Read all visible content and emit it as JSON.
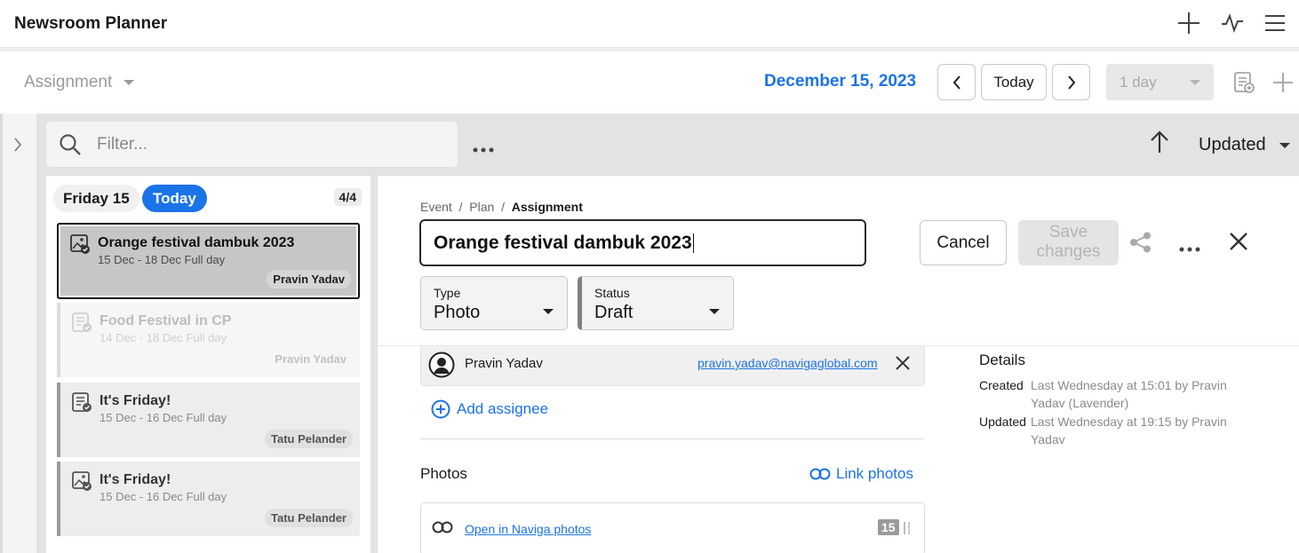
{
  "app": {
    "title": "Newsroom Planner"
  },
  "toolbar": {
    "view_label": "Assignment",
    "date": "December 15, 2023",
    "today_label": "Today",
    "period_label": "1 day"
  },
  "filter": {
    "placeholder": "Filter...",
    "sort_label": "Updated"
  },
  "list": {
    "day_label": "Friday 15",
    "today_badge": "Today",
    "count": "4/4",
    "items": [
      {
        "title": "Orange festival dambuk 2023",
        "dates": "15 Dec - 18 Dec Full day",
        "assignee": "Pravin Yadav",
        "icon": "image-check-icon",
        "state": "selected"
      },
      {
        "title": "Food Festival in CP",
        "dates": "14 Dec - 18 Dec Full day",
        "assignee": "Pravin Yadav",
        "icon": "article-check-icon",
        "state": "faded"
      },
      {
        "title": "It's Friday!",
        "dates": "15 Dec - 16 Dec Full day",
        "assignee": "Tatu Pelander",
        "icon": "article-check-icon",
        "state": "normal"
      },
      {
        "title": "It's Friday!",
        "dates": "15 Dec - 16 Dec Full day",
        "assignee": "Tatu Pelander",
        "icon": "image-check-icon",
        "state": "normal"
      }
    ]
  },
  "detail": {
    "breadcrumb": [
      "Event",
      "Plan",
      "Assignment"
    ],
    "title_value": "Orange festival dambuk 2023",
    "cancel_label": "Cancel",
    "save_label": "Save changes",
    "type": {
      "label": "Type",
      "value": "Photo"
    },
    "status": {
      "label": "Status",
      "value": "Draft"
    },
    "assignee": {
      "name": "Pravin Yadav",
      "email": "pravin.yadav@navigaglobal.com"
    },
    "add_assignee_label": "Add assignee",
    "photos_label": "Photos",
    "link_photos_label": "Link photos",
    "open_photos_label": "Open in Naviga photos",
    "photos_count": "15"
  },
  "details": {
    "title": "Details",
    "created_label": "Created",
    "created_value": "Last Wednesday at 15:01 by Pravin Yadav (Lavender)",
    "updated_label": "Updated",
    "updated_value": "Last Wednesday at 19:15 by Pravin Yadav"
  },
  "colors": {
    "accent": "#1b73e8",
    "selected_card": "#c6c6c6",
    "work_bg": "#e3e3e3"
  }
}
